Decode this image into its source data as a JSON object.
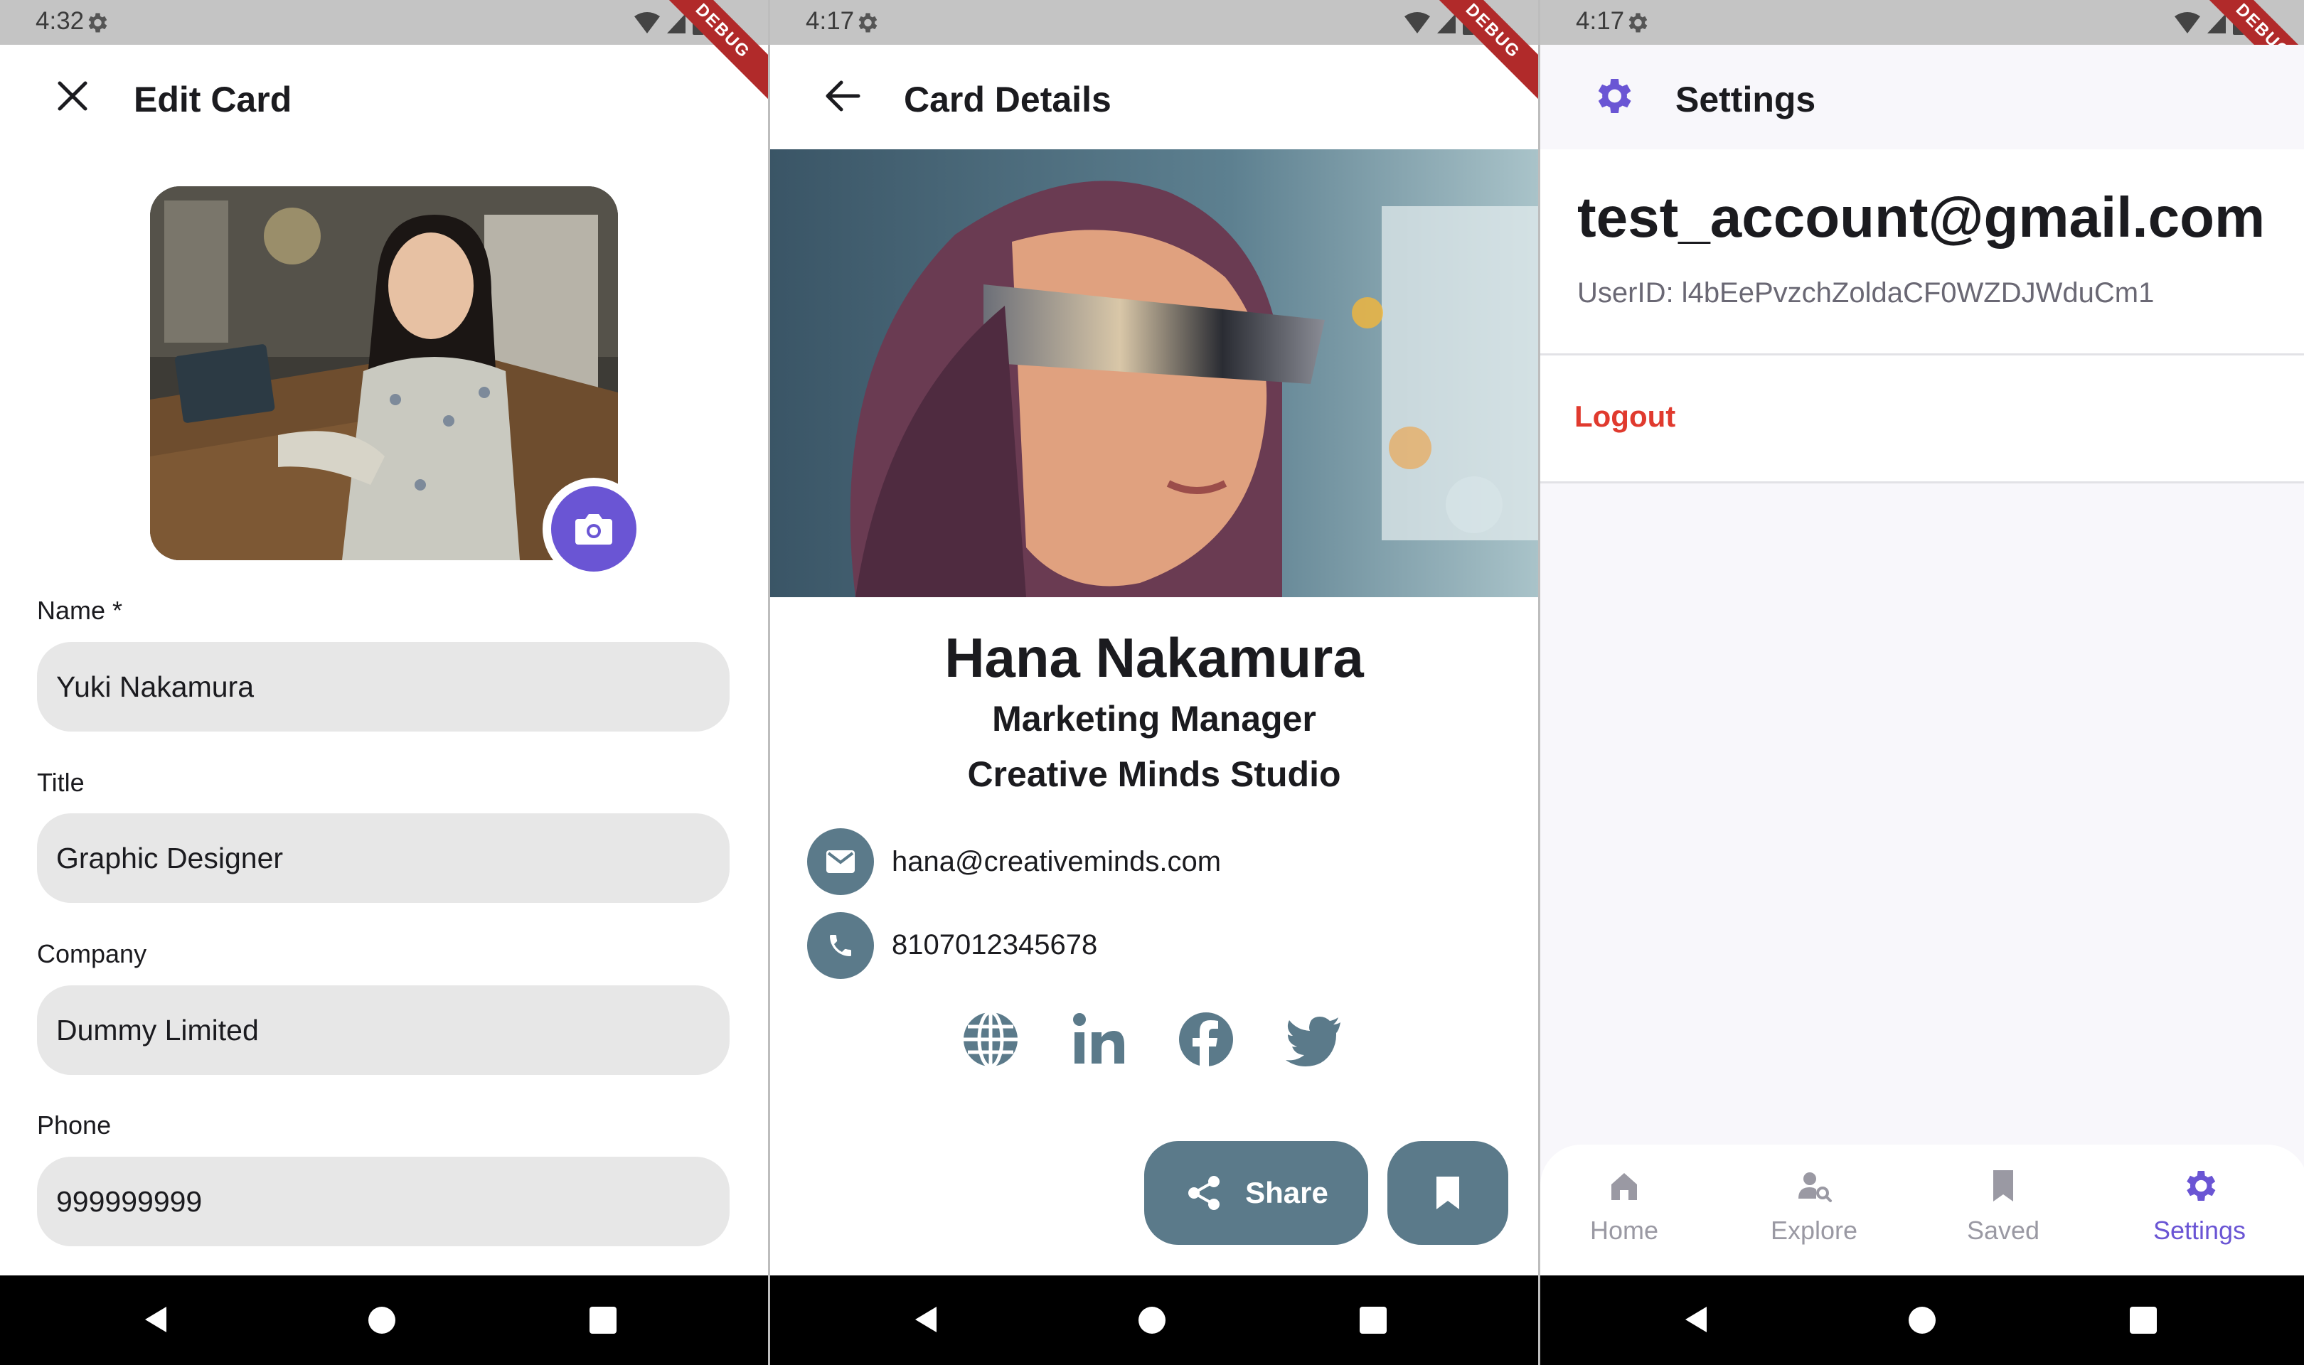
{
  "edit_card": {
    "status_time": "4:32",
    "debug_banner": "DEBUG",
    "title": "Edit Card",
    "fields": {
      "name_label": "Name *",
      "name_value": "Yuki Nakamura",
      "title_label": "Title",
      "title_value": "Graphic Designer",
      "company_label": "Company",
      "company_value": "Dummy Limited",
      "phone_label": "Phone",
      "phone_value": "999999999"
    }
  },
  "card_details": {
    "status_time": "4:17",
    "debug_banner": "DEBUG",
    "title": "Card Details",
    "name": "Hana Nakamura",
    "job_title": "Marketing Manager",
    "company": "Creative Minds Studio",
    "email": "hana@creativeminds.com",
    "phone": "8107012345678",
    "social_icons": [
      "globe-icon",
      "linkedin-icon",
      "facebook-icon",
      "twitter-icon"
    ],
    "share_label": "Share"
  },
  "settings": {
    "status_time": "4:17",
    "debug_banner": "DEBUG",
    "title": "Settings",
    "email": "test_account@gmail.com",
    "user_id": "UserID: l4bEePvzchZoldaCF0WZDJWduCm1",
    "logout_label": "Logout",
    "nav": {
      "items": [
        {
          "label": "Home",
          "icon": "home-icon"
        },
        {
          "label": "Explore",
          "icon": "explore-icon"
        },
        {
          "label": "Saved",
          "icon": "bookmark-icon"
        },
        {
          "label": "Settings",
          "icon": "gear-icon"
        }
      ],
      "active": "Settings"
    }
  },
  "colors": {
    "accent": "#6a55d4",
    "slate": "#5b7a8a",
    "logout": "#e03a2e",
    "field_bg": "#e7e7e7"
  }
}
